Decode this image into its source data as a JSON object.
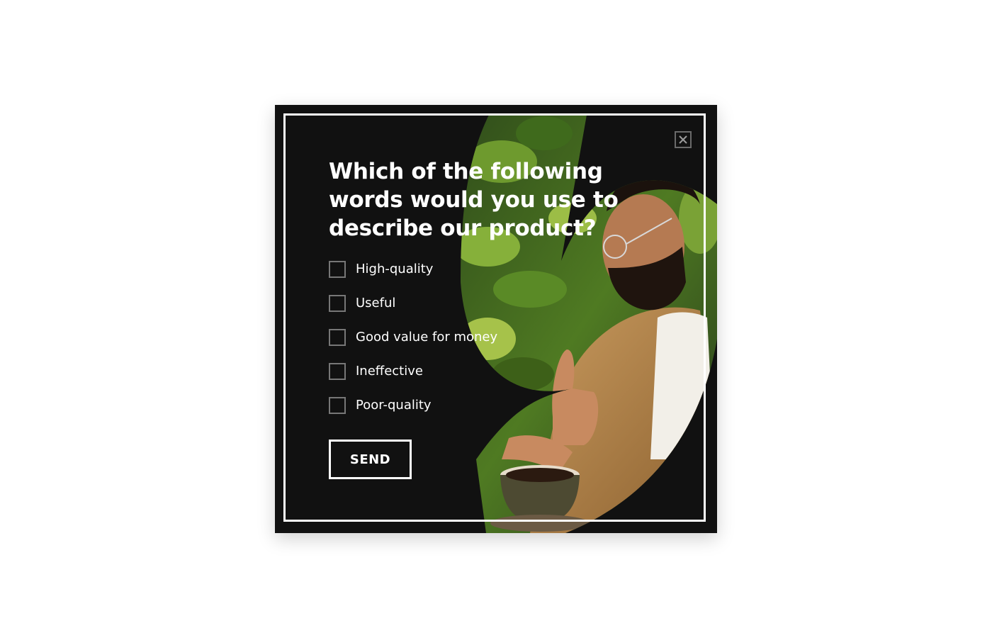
{
  "popup": {
    "title": "Which of the following words would you use to describe our product?",
    "options": [
      {
        "label": "High-quality",
        "checked": false
      },
      {
        "label": "Useful",
        "checked": false
      },
      {
        "label": "Good value for money",
        "checked": false
      },
      {
        "label": "Ineffective",
        "checked": false
      },
      {
        "label": "Poor-quality",
        "checked": false
      }
    ],
    "send_label": "SEND",
    "close_icon": "close-icon",
    "photo_description_icon": "product-photo"
  },
  "colors": {
    "background": "#111111",
    "text": "#ffffff",
    "frame": "#ffffff",
    "checkbox_border": "#777777",
    "page": "#ffffff"
  }
}
